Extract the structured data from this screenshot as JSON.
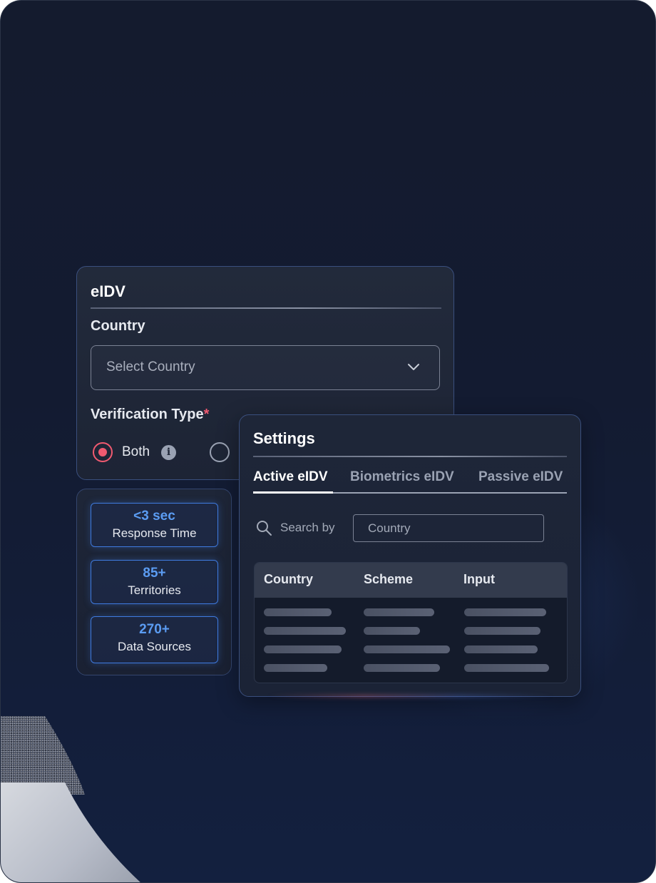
{
  "eidv": {
    "title": "eIDV",
    "country_label": "Country",
    "country_placeholder": "Select Country",
    "verification_label": "Verification Type",
    "required_mark": "*",
    "radio_both_label": "Both"
  },
  "stats": [
    {
      "value": "<3 sec",
      "label": "Response Time"
    },
    {
      "value": "85+",
      "label": "Territories"
    },
    {
      "value": "270+",
      "label": "Data Sources"
    }
  ],
  "settings": {
    "title": "Settings",
    "tabs": [
      "Active eIDV",
      "Biometrics eIDV",
      "Passive eIDV"
    ],
    "active_tab": "Active eIDV",
    "search_label": "Search by",
    "search_value": "Country",
    "table_headers": [
      "Country",
      "Scheme",
      "Input"
    ]
  },
  "icons": {
    "chevron": "chevron-down-icon",
    "info": "info-icon",
    "search": "search-icon"
  },
  "colors": {
    "accent_red": "#f05a70",
    "accent_blue": "#5b9cf2",
    "background": "#141b2e"
  }
}
